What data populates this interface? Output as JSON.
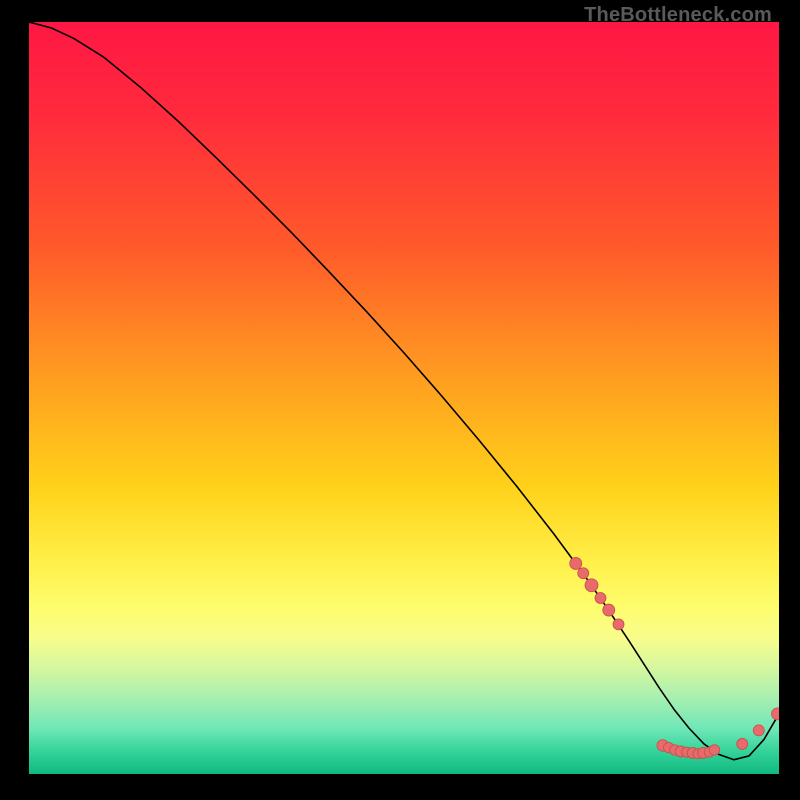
{
  "watermark": "TheBottleneck.com",
  "chart_data": {
    "type": "line",
    "title": "",
    "xlabel": "",
    "ylabel": "",
    "xlim": [
      0,
      100
    ],
    "ylim": [
      0,
      100
    ],
    "series": [
      {
        "name": "curve",
        "x": [
          0,
          3,
          6,
          10,
          15,
          20,
          25,
          30,
          35,
          40,
          45,
          50,
          55,
          60,
          65,
          70,
          74,
          77,
          80,
          82,
          84,
          86,
          88,
          90,
          92,
          94,
          96,
          98,
          100
        ],
        "y": [
          100,
          99.2,
          97.8,
          95.3,
          91.2,
          86.7,
          81.9,
          77.0,
          72.0,
          66.8,
          61.5,
          56.0,
          50.3,
          44.4,
          38.3,
          31.9,
          26.5,
          22.2,
          17.7,
          14.6,
          11.5,
          8.6,
          6.1,
          4.0,
          2.6,
          1.9,
          2.4,
          4.6,
          8.0
        ]
      }
    ],
    "markers": [
      {
        "x": 72.9,
        "y": 28.0,
        "r": 6.0
      },
      {
        "x": 73.9,
        "y": 26.7,
        "r": 5.5
      },
      {
        "x": 75.0,
        "y": 25.1,
        "r": 6.5
      },
      {
        "x": 76.2,
        "y": 23.4,
        "r": 5.5
      },
      {
        "x": 77.3,
        "y": 21.8,
        "r": 6.0
      },
      {
        "x": 78.6,
        "y": 19.9,
        "r": 5.5
      },
      {
        "x": 84.5,
        "y": 3.8,
        "r": 5.8
      },
      {
        "x": 85.3,
        "y": 3.5,
        "r": 5.2
      },
      {
        "x": 86.1,
        "y": 3.2,
        "r": 5.2
      },
      {
        "x": 86.9,
        "y": 3.0,
        "r": 5.5
      },
      {
        "x": 87.7,
        "y": 2.9,
        "r": 5.0
      },
      {
        "x": 88.5,
        "y": 2.8,
        "r": 5.5
      },
      {
        "x": 89.2,
        "y": 2.7,
        "r": 5.0
      },
      {
        "x": 89.9,
        "y": 2.8,
        "r": 5.5
      },
      {
        "x": 90.7,
        "y": 2.9,
        "r": 5.0
      },
      {
        "x": 91.4,
        "y": 3.2,
        "r": 5.2
      },
      {
        "x": 95.1,
        "y": 4.0,
        "r": 5.5
      },
      {
        "x": 97.3,
        "y": 5.8,
        "r": 5.5
      },
      {
        "x": 99.8,
        "y": 8.0,
        "r": 6.0
      }
    ],
    "marker_color": "#e86a6a",
    "marker_stroke": "#c44e4e",
    "line_color": "#000000"
  }
}
